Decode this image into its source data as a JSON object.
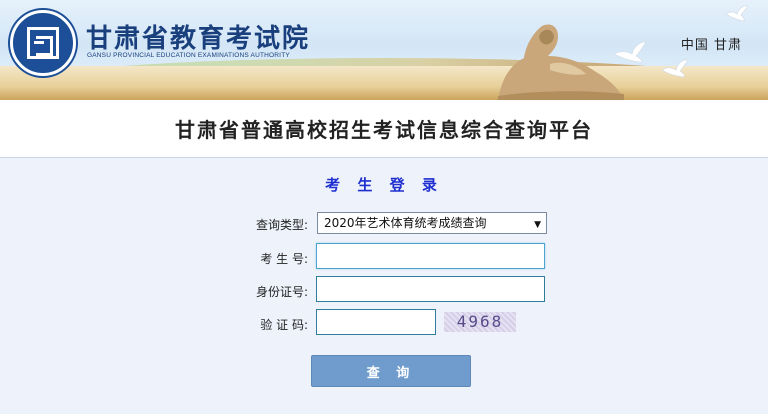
{
  "header": {
    "org_name": "甘肃省教育考试院",
    "org_name_en": "GANSU PROVINCIAL EDUCATION EXAMINATIONS AUTHORITY",
    "region_text": "中国  甘肃",
    "logo_icon": "exam-authority-seal-icon"
  },
  "page": {
    "title": "甘肃省普通高校招生考试信息综合查询平台"
  },
  "login": {
    "heading": "考 生 登 录",
    "fields": {
      "query_type_label": "查询类型:",
      "query_type_value": "2020年艺术体育统考成绩查询",
      "candidate_no_label": "考 生 号:",
      "candidate_no_value": "",
      "id_no_label": "身份证号:",
      "id_no_value": "",
      "captcha_label": "验 证 码:",
      "captcha_value": "",
      "captcha_image_text": "4968"
    },
    "submit_label": "查 询"
  },
  "colors": {
    "brand_blue": "#1a3f7d",
    "heading_blue": "#1f2fd0",
    "button_blue": "#6f9ccc"
  }
}
